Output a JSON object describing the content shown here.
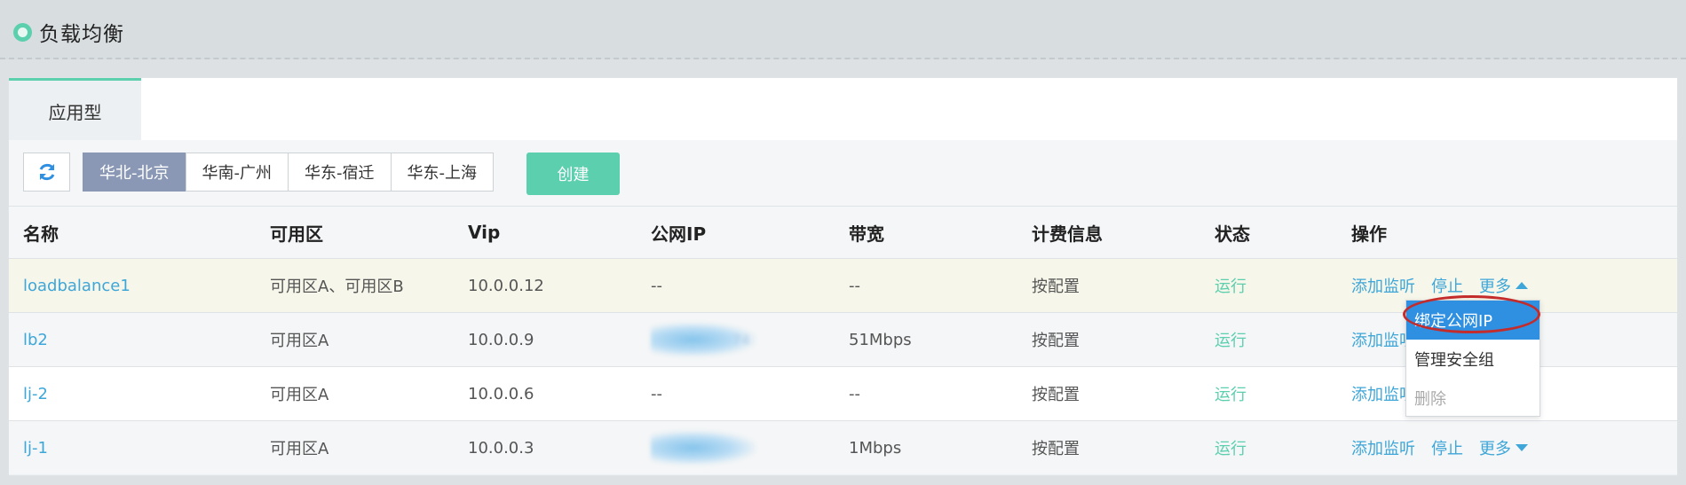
{
  "header": {
    "title": "负载均衡"
  },
  "tabs": [
    {
      "label": "应用型",
      "active": true
    }
  ],
  "toolbar": {
    "refresh_icon": "refresh-icon",
    "regions": [
      {
        "label": "华北-北京",
        "active": true
      },
      {
        "label": "华南-广州",
        "active": false
      },
      {
        "label": "华东-宿迁",
        "active": false
      },
      {
        "label": "华东-上海",
        "active": false
      }
    ],
    "create_label": "创建"
  },
  "table": {
    "columns": [
      "名称",
      "可用区",
      "Vip",
      "公网IP",
      "带宽",
      "计费信息",
      "状态",
      "操作"
    ],
    "rows": [
      {
        "name": "loadbalance1",
        "az": "可用区A、可用区B",
        "vip": "10.0.0.12",
        "ip": "--",
        "bw": "--",
        "bill": "按配置",
        "status": "运行",
        "ops": [
          "添加监听",
          "停止",
          "更多"
        ]
      },
      {
        "name": "lb2",
        "az": "可用区A",
        "vip": "10.0.0.9",
        "ip": "74",
        "bw": "51Mbps",
        "bill": "按配置",
        "status": "运行",
        "ops": [
          "添加监听"
        ]
      },
      {
        "name": "lj-2",
        "az": "可用区A",
        "vip": "10.0.0.6",
        "ip": "--",
        "bw": "--",
        "bill": "按配置",
        "status": "运行",
        "ops": [
          "添加监听"
        ]
      },
      {
        "name": "lj-1",
        "az": "可用区A",
        "vip": "10.0.0.3",
        "ip": "",
        "bw": "1Mbps",
        "bill": "按配置",
        "status": "运行",
        "ops": [
          "添加监听",
          "停止",
          "更多"
        ]
      }
    ]
  },
  "dropdown": {
    "items": [
      {
        "label": "绑定公网IP",
        "selected": true
      },
      {
        "label": "管理安全组",
        "selected": false
      },
      {
        "label": "删除",
        "disabled": true
      }
    ]
  },
  "colors": {
    "accent": "#5ccfae",
    "link": "#3ea6d8",
    "region_active": "#8a98b6",
    "highlight": "#c42b2b"
  }
}
